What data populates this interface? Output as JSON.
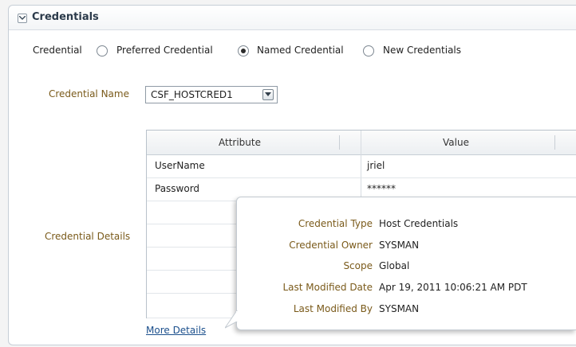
{
  "section": {
    "title": "Credentials"
  },
  "credential": {
    "label": "Credential",
    "options": [
      {
        "label": "Preferred Credential",
        "selected": false
      },
      {
        "label": "Named Credential",
        "selected": true
      },
      {
        "label": "New Credentials",
        "selected": false
      }
    ]
  },
  "credential_name": {
    "label": "Credential Name",
    "value": "CSF_HOSTCRED1"
  },
  "credential_details": {
    "label": "Credential Details",
    "columns": [
      "Attribute",
      "Value"
    ],
    "rows": [
      {
        "attribute": "UserName",
        "value": "jriel"
      },
      {
        "attribute": "Password",
        "value": "******"
      }
    ]
  },
  "popup": {
    "fields": [
      {
        "label": "Credential Type",
        "value": "Host Credentials"
      },
      {
        "label": "Credential Owner",
        "value": "SYSMAN"
      },
      {
        "label": "Scope",
        "value": "Global"
      },
      {
        "label": "Last Modified Date",
        "value": "Apr 19, 2011 10:06:21 AM PDT"
      },
      {
        "label": "Last Modified By",
        "value": "SYSMAN"
      }
    ]
  },
  "more_details": "More Details",
  "colors": {
    "field_label": "#7a5a1a",
    "link": "#1b4f8c",
    "border": "#c6ced6"
  }
}
